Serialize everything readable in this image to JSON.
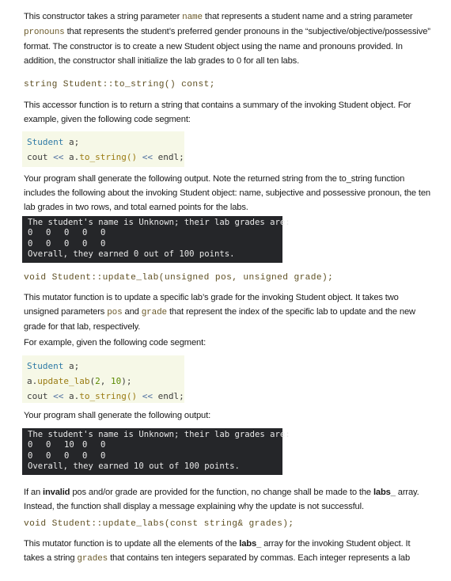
{
  "intro": {
    "p1_a": "This constructor takes a string parameter ",
    "p1_name": "name",
    "p1_b": " that represents a student name and a string parameter ",
    "p1_pronouns": "pronouns",
    "p1_c": " that represents the student’s preferred gender pronouns in the “subjective/objective/possessive” format. The constructor is to create a new Student object using the name and pronouns provided. In addition, the constructor shall initialize the lab grades to 0 for all ten labs."
  },
  "to_string": {
    "signature": "string Student::to_string() const;",
    "description": "This accessor function is to return a string that contains a summary of the invoking Student object. For example, given the following code segment:",
    "code": {
      "line1_type": "Student",
      "line1_rest": " a;",
      "line2_a": "cout ",
      "line2_op1": "<<",
      "line2_b": " a.",
      "line2_fn": "to_string()",
      "line2_c": " ",
      "line2_op2": "<<",
      "line2_d": " endl;"
    },
    "output_intro": "Your program shall generate the following output. Note the returned string from the to_string function includes the following about the invoking Student object: name, subjective and possessive pronoun, the ten lab grades in two rows, and total earned points for the labs.",
    "terminal": {
      "header": "The student's name is Unknown; their lab grades are:",
      "row1": [
        "0",
        "0",
        "0",
        "0",
        "0"
      ],
      "row2": [
        "0",
        "0",
        "0",
        "0",
        "0"
      ],
      "footer": "Overall, they earned 0 out of 100 points."
    }
  },
  "update_lab": {
    "signature": "void Student::update_lab(unsigned pos, unsigned grade);",
    "desc_a": "This mutator function is to update a specific lab’s grade for the invoking Student object. It takes two unsigned parameters ",
    "desc_pos": "pos",
    "desc_b": " and ",
    "desc_grade": "grade",
    "desc_c": " that represent the index of the specific lab to update and the new grade for that lab, respectively.",
    "example_intro": "For example, given the following code segment:",
    "code": {
      "line1_type": "Student",
      "line1_rest": " a;",
      "line2_a": "a.",
      "line2_fn": "update_lab",
      "line2_b": "(",
      "line2_n1": "2",
      "line2_c": ", ",
      "line2_n2": "10",
      "line2_d": ");",
      "line3_a": "cout ",
      "line3_op1": "<<",
      "line3_b": " a.",
      "line3_fn": "to_string()",
      "line3_c": " ",
      "line3_op2": "<<",
      "line3_d": " endl;"
    },
    "output_intro": "Your program shall generate the following output:",
    "terminal": {
      "header": "The student's name is Unknown; their lab grades are:",
      "row1": [
        "0",
        "0",
        "10",
        "0",
        "0"
      ],
      "row2": [
        "0",
        "0",
        "0",
        "0",
        "0"
      ],
      "footer": "Overall, they earned 10 out of 100 points."
    },
    "invalid_a": "If an ",
    "invalid_bold": "invalid",
    "invalid_b": " pos and/or grade are provided for the function, no change shall be made to the ",
    "invalid_labs": "labs_",
    "invalid_c": " array. Instead, the function shall display a message explaining why the update is not successful."
  },
  "update_labs": {
    "signature": "void Student::update_labs(const string& grades);",
    "desc_a": "This mutator function is to update all the elements of the ",
    "desc_labs": "labs_",
    "desc_b": " array for the invoking Student object. It takes a string ",
    "desc_grades": "grades",
    "desc_c": " that contains ten integers separated by commas. Each integer represents a lab"
  }
}
